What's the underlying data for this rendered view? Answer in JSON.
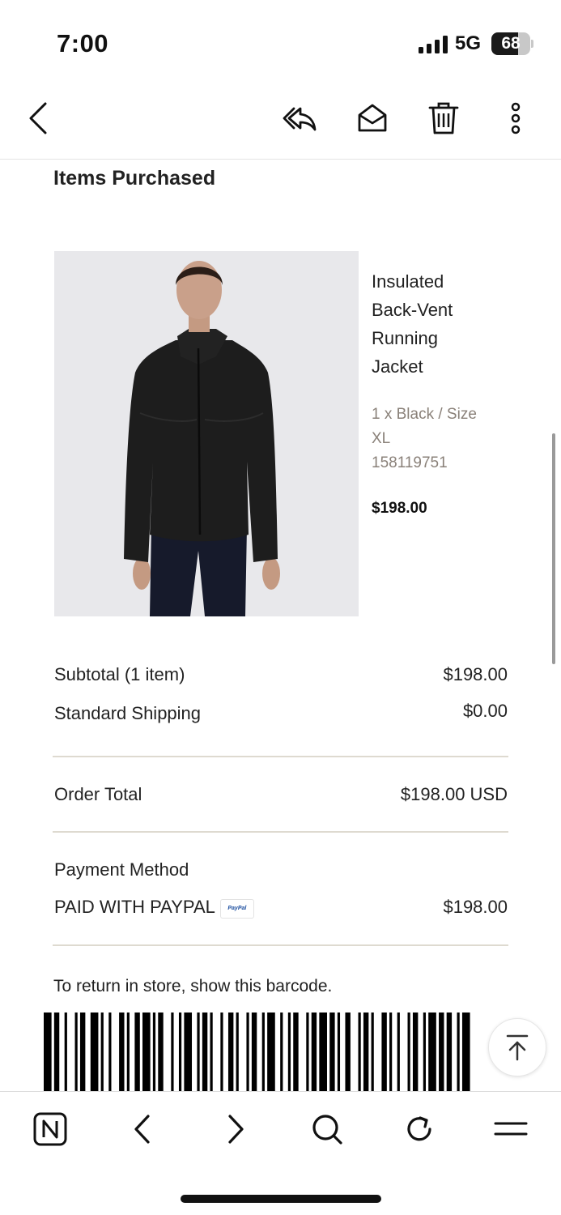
{
  "status_bar": {
    "time": "7:00",
    "network": "5G",
    "battery": "68",
    "battery_level": 0.68
  },
  "toolbar": {
    "icons": [
      "back-chevron-icon",
      "reply-all-icon",
      "mark-unread-icon",
      "trash-icon",
      "more-vertical-icon"
    ]
  },
  "items_section": {
    "title": "Items Purchased"
  },
  "product": {
    "name": "Insulated Back-Vent Running Jacket",
    "variant": "1 x Black / Size XL",
    "sku": "158119751",
    "price": "$198.00"
  },
  "summary": {
    "subtotal_label": "Subtotal (1 item)",
    "subtotal_value": "$198.00",
    "shipping_label": "Standard Shipping",
    "shipping_value": "$0.00",
    "total_label": "Order Total",
    "total_value": "$198.00 USD"
  },
  "payment": {
    "label": "Payment Method",
    "method": "PAID WITH PAYPAL",
    "logo_text": "PayPal",
    "amount": "$198.00"
  },
  "return_note": "To return in store, show this barcode.",
  "barcode_pattern": [
    3,
    1,
    2,
    2,
    1,
    3,
    1,
    1,
    2,
    2,
    3,
    1,
    1,
    2,
    1,
    3,
    2,
    1,
    1,
    2,
    2,
    1,
    3,
    1,
    1,
    1,
    2,
    3,
    1,
    2,
    1,
    1,
    3,
    2,
    1,
    1,
    2,
    1,
    1,
    3,
    1,
    2,
    2,
    1,
    1,
    3,
    1,
    1,
    2,
    2,
    1,
    1,
    3,
    2,
    1,
    2,
    1,
    1,
    2,
    3,
    1,
    1,
    2,
    1,
    3,
    1,
    2,
    1,
    1,
    2,
    2,
    3,
    1,
    1,
    2,
    1,
    1,
    3,
    2,
    1,
    1,
    2,
    1,
    3,
    1,
    1,
    2,
    2,
    1,
    1,
    3,
    1,
    2,
    1,
    2,
    2,
    1,
    1,
    3,
    2
  ],
  "bottom_nav": {
    "icons": [
      "notion-icon",
      "back-icon",
      "forward-icon",
      "search-icon",
      "reload-icon",
      "menu-icon"
    ]
  }
}
